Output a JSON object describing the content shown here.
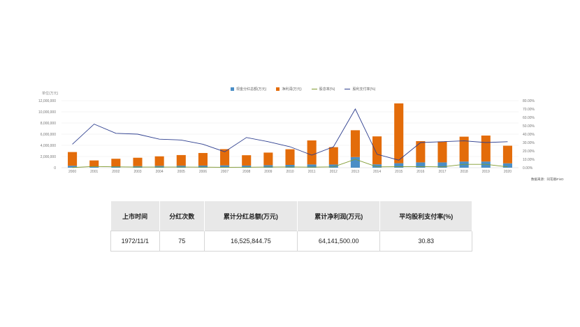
{
  "chart_data": {
    "type": "bar",
    "stacked": true,
    "unit_label": "单位(万元)",
    "categories": [
      "2000",
      "2001",
      "2002",
      "2003",
      "2004",
      "2005",
      "2006",
      "2007",
      "2008",
      "2009",
      "2010",
      "2011",
      "2012",
      "2013",
      "2014",
      "2015",
      "2016",
      "2017",
      "2018",
      "2019",
      "2020"
    ],
    "series": [
      {
        "name": "现金分红总额(万元)",
        "kind": "bar",
        "color": "#4a8ec6",
        "values": [
          350000,
          150000,
          250000,
          280000,
          330000,
          360000,
          380000,
          420000,
          380000,
          450000,
          500000,
          580000,
          570000,
          1900000,
          600000,
          800000,
          950000,
          950000,
          1100000,
          1100000,
          780000
        ]
      },
      {
        "name": "净利润(万元)",
        "kind": "bar",
        "color": "#e36c0a",
        "values": [
          2450000,
          1150000,
          1350000,
          1500000,
          1700000,
          1900000,
          2250000,
          2900000,
          1850000,
          2250000,
          2800000,
          4300000,
          3100000,
          4800000,
          5000000,
          10700000,
          3800000,
          3750000,
          4450000,
          4650000,
          3150000
        ]
      },
      {
        "name": "股息率(%)",
        "kind": "line",
        "axis": "right",
        "color": "#7f9a2e",
        "values": [
          0.2,
          1.5,
          1.0,
          0.8,
          0.8,
          0.8,
          0.7,
          0.5,
          0.6,
          0.8,
          0.9,
          0.7,
          1.0,
          10.0,
          1.0,
          1.2,
          1.3,
          1.0,
          4.0,
          4.0,
          1.0
        ]
      },
      {
        "name": "股利支付率(%)",
        "kind": "line",
        "axis": "right",
        "color": "#2e3f8f",
        "values": [
          28,
          52,
          41,
          40,
          34,
          33,
          28,
          19,
          36,
          31,
          25,
          15,
          25,
          70,
          16,
          9,
          30,
          31,
          32,
          30,
          31
        ]
      }
    ],
    "y_left_ticks": [
      "0",
      "2,000,000",
      "4,000,000",
      "6,000,000",
      "8,000,000",
      "10,000,000",
      "12,000,000"
    ],
    "y_left_range": [
      0,
      12000000
    ],
    "y_right_ticks": [
      "0.00%",
      "10.00%",
      "20.00%",
      "30.00%",
      "40.00%",
      "50.00%",
      "60.00%",
      "70.00%",
      "80.00%"
    ],
    "y_right_range": [
      0,
      80
    ],
    "grid": true,
    "legend_position": "top-center",
    "source": "数据来源：同花顺iFinD"
  },
  "table": {
    "headers": [
      "上市时间",
      "分红次数",
      "累计分红总额(万元)",
      "累计净利润(万元)",
      "平均股利支付率(%)"
    ],
    "row": [
      "1972/11/1",
      "75",
      "16,525,844.75",
      "64,141,500.00",
      "30.83"
    ]
  }
}
